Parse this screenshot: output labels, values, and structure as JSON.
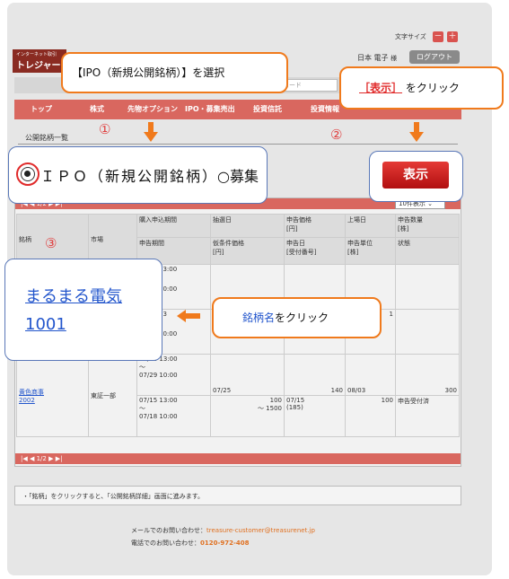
{
  "header": {
    "logo_small": "インターネット取引",
    "logo_main": "トレジャー",
    "font_size_label": "文字サイズ",
    "font_minus": "－",
    "font_plus": "＋",
    "username": "日本 電子",
    "honorific": "様",
    "logout": "ログアウト",
    "code_placeholder": "コード"
  },
  "nav": {
    "items": [
      "トップ",
      "株式",
      "先物オプション",
      "IPO・募集売出",
      "投資信託",
      "投資情報"
    ]
  },
  "section_title": "公開銘柄一覧",
  "callouts": {
    "step1_text": "【IPO（新規公開銘柄）】を選択",
    "step2_tag": "［表示］",
    "step2_text": "をクリック",
    "step3_blue": "銘柄名",
    "step3_text": "をクリック"
  },
  "steps": {
    "one": "①",
    "two": "②",
    "three": "③"
  },
  "filter": {
    "ipo_label": "ＩＰＯ（新規公開銘柄）",
    "offering_label": "○募集",
    "show_button": "表示"
  },
  "table": {
    "pager_top": "1/2",
    "pager_bottom": "1/2",
    "per_page": "10件表示",
    "headers_row1": [
      "購入申込期間",
      "抽選日",
      "申告価格",
      "上場日",
      "申告数量"
    ],
    "headers_row1_units": [
      "[円]",
      "[株]"
    ],
    "headers_row2": [
      "申告期間",
      "仮条件価格",
      "申告日",
      "申告単位",
      "状態"
    ],
    "headers_row2_units": [
      "[円]",
      "[受付番号]",
      "[株]"
    ],
    "col_meigara": "銘柄",
    "col_market": "市場",
    "row1": {
      "times": [
        "13:00",
        "10:00",
        "13",
        "10:00"
      ],
      "quantity_partial": "1"
    },
    "row2": {
      "name": "黄色商事",
      "code": "2002",
      "market": "東証一部",
      "apply_start": "07/26 13:00",
      "tilde1": "～",
      "apply_end": "07/29 10:00",
      "lottery_date": "07/25",
      "price": "140",
      "listing_date": "08/03",
      "quantity": "300",
      "decl_start": "07/15 13:00",
      "tilde2": "～",
      "decl_end": "07/18 10:00",
      "tentative_low": "100",
      "tentative_high": "～ 1500",
      "decl_date": "07/15",
      "receipt_no": "(185)",
      "unit": "100",
      "status": "申告受付済"
    }
  },
  "featured_link": {
    "name": "まるまる電気",
    "code": "1001"
  },
  "note": "・「銘柄」をクリックすると、「公開銘柄詳細」画面に進みます。",
  "footer": {
    "mail_label": "メールでのお問い合わせ：",
    "mail": "treasure-customer@treasurenet.jp",
    "phone_label": "電話でのお問い合わせ：",
    "phone": "0120-972-408"
  }
}
